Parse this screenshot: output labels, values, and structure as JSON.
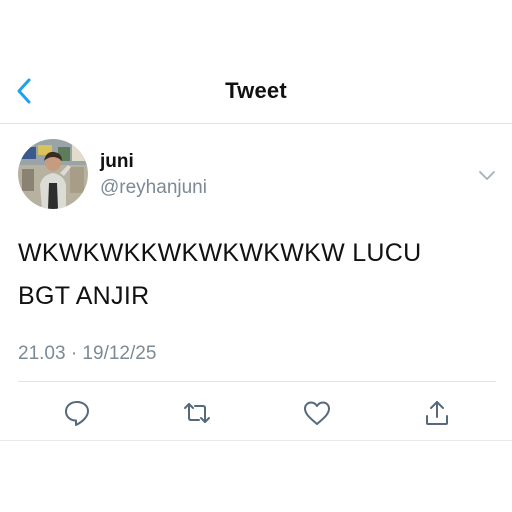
{
  "header": {
    "title": "Tweet",
    "back_icon": "chevron-left-icon"
  },
  "tweet": {
    "author": {
      "name": "juni",
      "handle": "@reyhanjuni",
      "avatar": "avatar-photo"
    },
    "text_lines": [
      "WKWKWKKWKWKWKWKW LUCU",
      "BGT ANJIR"
    ],
    "timestamp": "21.03 · 19/12/25",
    "menu_icon": "chevron-down-icon"
  },
  "actions": [
    {
      "icon": "reply-icon"
    },
    {
      "icon": "retweet-icon"
    },
    {
      "icon": "like-icon"
    },
    {
      "icon": "share-icon"
    }
  ],
  "colors": {
    "accent": "#1da1f2",
    "text": "#111111",
    "secondary_text": "#7b8a96",
    "divider": "#dfe3e6"
  }
}
